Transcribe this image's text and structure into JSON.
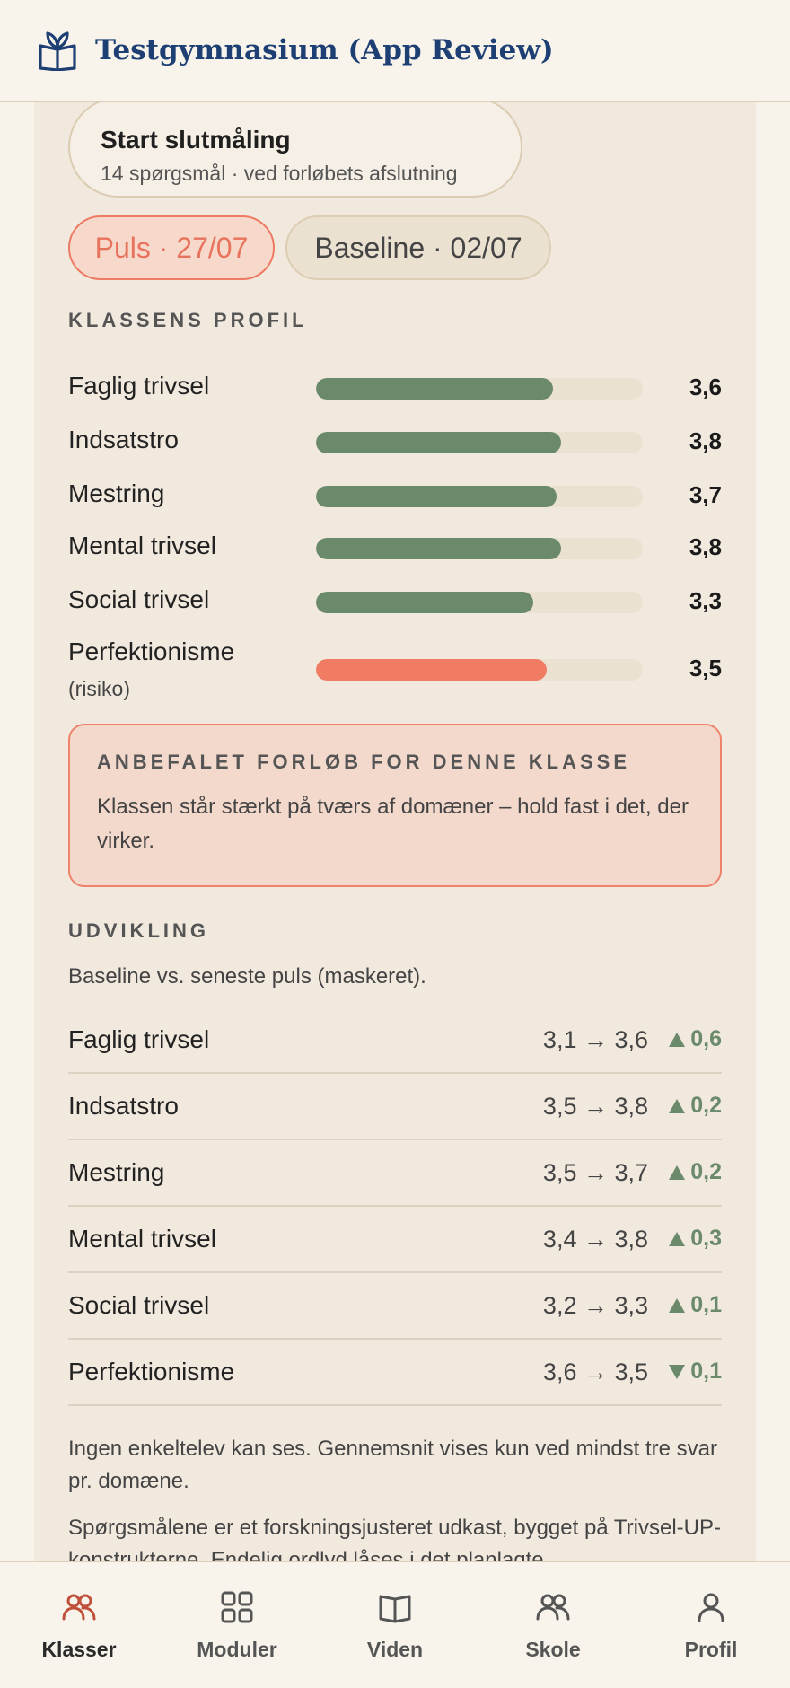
{
  "header": {
    "title": "Testgymnasium (App Review)",
    "logo_icon": "book-sprout-icon"
  },
  "start_button": {
    "title": "Start slutmåling",
    "subtitle": "14 spørgsmål · ved forløbets afslutning"
  },
  "chips": [
    {
      "label": "Puls · 27/07",
      "active": true
    },
    {
      "label": "Baseline · 02/07",
      "active": false
    }
  ],
  "profile": {
    "heading": "KLASSENS PROFIL",
    "items": [
      {
        "label": "Faglig trivsel",
        "sub": "",
        "value": "3,6",
        "fill": 0.725,
        "color": "#6b8a6b"
      },
      {
        "label": "Indsatstro",
        "sub": "",
        "value": "3,8",
        "fill": 0.75,
        "color": "#6b8a6b"
      },
      {
        "label": "Mestring",
        "sub": "",
        "value": "3,7",
        "fill": 0.735,
        "color": "#6b8a6b"
      },
      {
        "label": "Mental trivsel",
        "sub": "",
        "value": "3,8",
        "fill": 0.75,
        "color": "#6b8a6b"
      },
      {
        "label": "Social trivsel",
        "sub": "",
        "value": "3,3",
        "fill": 0.665,
        "color": "#6b8a6b"
      },
      {
        "label": "Perfektionisme",
        "sub": "(risiko)",
        "value": "3,5",
        "fill": 0.705,
        "color": "#f07c63"
      }
    ]
  },
  "recommendation": {
    "heading": "ANBEFALET FORLØB FOR DENNE KLASSE",
    "body": "Klassen står stærkt på tværs af domæner – hold fast i det, der virker."
  },
  "development": {
    "heading": "UDVIKLING",
    "intro": "Baseline vs. seneste puls (maskeret).",
    "rows": [
      {
        "name": "Faglig trivsel",
        "change": "3,1 → 3,6",
        "delta": "0,6",
        "direction": "up"
      },
      {
        "name": "Indsatstro",
        "change": "3,5 → 3,8",
        "delta": "0,2",
        "direction": "up"
      },
      {
        "name": "Mestring",
        "change": "3,5 → 3,7",
        "delta": "0,2",
        "direction": "up"
      },
      {
        "name": "Mental trivsel",
        "change": "3,4 → 3,8",
        "delta": "0,3",
        "direction": "up"
      },
      {
        "name": "Social trivsel",
        "change": "3,2 → 3,3",
        "delta": "0,1",
        "direction": "up"
      },
      {
        "name": "Perfektionisme",
        "change": "3,6 → 3,5",
        "delta": "0,1",
        "direction": "down"
      }
    ]
  },
  "notes": [
    "Ingen enkeltelev kan ses. Gennemsnit vises kun ved mindst tre svar pr. domæne.",
    "Spørgsmålene er et forskningsjusteret udkast, bygget på Trivsel-UP-konstrukterne. Endelig ordlyd låses i det planlagte"
  ],
  "nav": {
    "items": [
      {
        "label": "Klasser",
        "icon": "users-icon",
        "active": true
      },
      {
        "label": "Moduler",
        "icon": "grid-icon",
        "active": false
      },
      {
        "label": "Viden",
        "icon": "book-icon",
        "active": false
      },
      {
        "label": "Skole",
        "icon": "users-icon",
        "active": false
      },
      {
        "label": "Profil",
        "icon": "user-icon",
        "active": false
      }
    ]
  },
  "colors": {
    "accent": "#e8735d",
    "positive": "#6b8a6b",
    "brand": "#1d3f73"
  }
}
